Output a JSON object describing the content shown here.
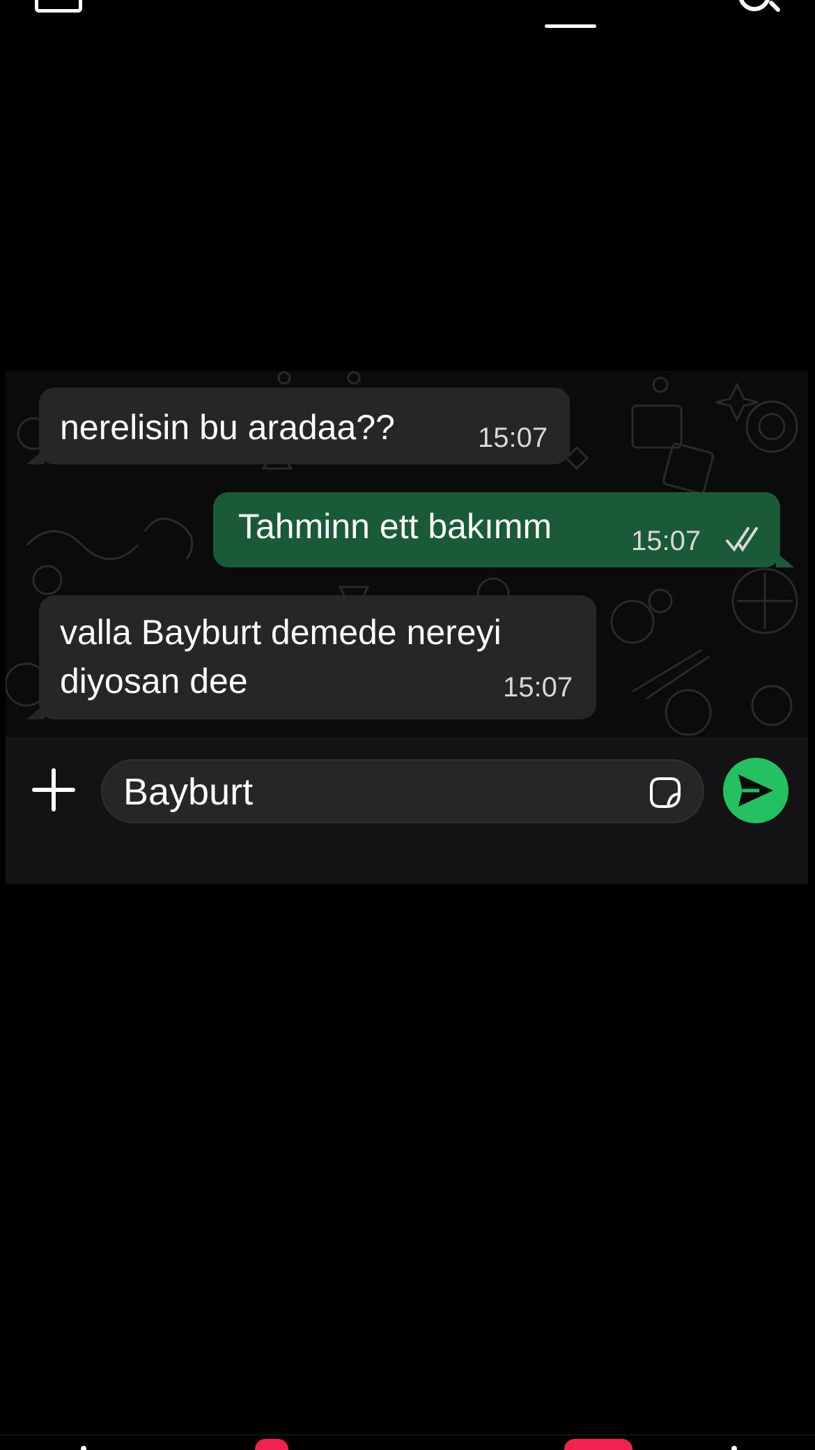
{
  "topnav": {
    "menu_icon": "menu-icon",
    "search_icon": "search-icon",
    "active_tab_indicator": true
  },
  "chat": {
    "messages": [
      {
        "direction": "incoming",
        "text": "nerelisin bu aradaa??",
        "time": "15:07"
      },
      {
        "direction": "outgoing",
        "text": "Tahminn ett bakımm",
        "time": "15:07",
        "status": "read"
      },
      {
        "direction": "incoming",
        "text": "valla Bayburt demede nereyi diyosan dee",
        "time": "15:07"
      }
    ],
    "composer": {
      "input_value": "Bayburt",
      "attach_icon": "plus-icon",
      "sticker_icon": "sticker-icon",
      "send_icon": "send-icon"
    },
    "colors": {
      "incoming_bubble": "#252628",
      "outgoing_bubble": "#1a5a36",
      "send_button": "#24c061"
    }
  },
  "bottombar": {
    "badge_color": "#f0224e"
  }
}
